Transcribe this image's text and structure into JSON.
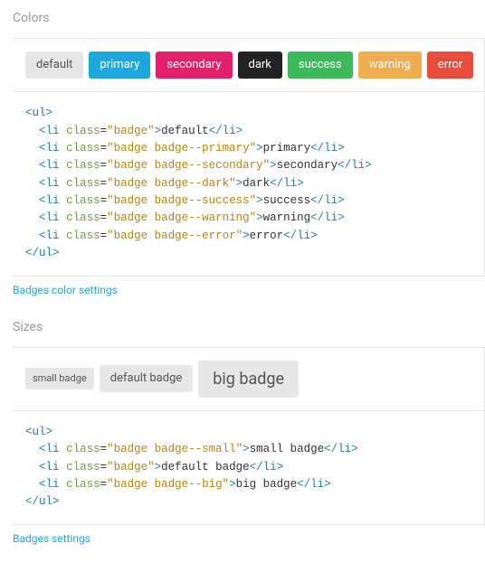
{
  "sections": {
    "colors": {
      "title": "Colors",
      "badges": [
        {
          "label": "default",
          "cls": "badge"
        },
        {
          "label": "primary",
          "cls": "badge badge--primary"
        },
        {
          "label": "secondary",
          "cls": "badge badge--secondary"
        },
        {
          "label": "dark",
          "cls": "badge badge--dark"
        },
        {
          "label": "success",
          "cls": "badge badge--success"
        },
        {
          "label": "warning",
          "cls": "badge badge--warning"
        },
        {
          "label": "error",
          "cls": "badge badge--error"
        }
      ],
      "code_lines": [
        {
          "tag": "ul",
          "open": true
        },
        {
          "tag": "li",
          "cls": "badge",
          "text": "default",
          "indent": 1
        },
        {
          "tag": "li",
          "cls": "badge badge--primary",
          "text": "primary",
          "indent": 1
        },
        {
          "tag": "li",
          "cls": "badge badge--secondary",
          "text": "secondary",
          "indent": 1
        },
        {
          "tag": "li",
          "cls": "badge badge--dark",
          "text": "dark",
          "indent": 1
        },
        {
          "tag": "li",
          "cls": "badge badge--success",
          "text": "success",
          "indent": 1
        },
        {
          "tag": "li",
          "cls": "badge badge--warning",
          "text": "warning",
          "indent": 1
        },
        {
          "tag": "li",
          "cls": "badge badge--error",
          "text": "error",
          "indent": 1
        },
        {
          "tag": "ul",
          "close": true
        }
      ],
      "link_label": "Badges color settings"
    },
    "sizes": {
      "title": "Sizes",
      "badges": [
        {
          "label": "small badge",
          "cls": "badge badge--small"
        },
        {
          "label": "default badge",
          "cls": "badge"
        },
        {
          "label": "big badge",
          "cls": "badge badge--big"
        }
      ],
      "code_lines": [
        {
          "tag": "ul",
          "open": true
        },
        {
          "tag": "li",
          "cls": "badge badge--small",
          "text": "small badge",
          "indent": 1
        },
        {
          "tag": "li",
          "cls": "badge",
          "text": "default badge",
          "indent": 1
        },
        {
          "tag": "li",
          "cls": "badge badge--big",
          "text": "big badge",
          "indent": 1
        },
        {
          "tag": "ul",
          "close": true
        }
      ],
      "link_label": "Badges settings"
    }
  }
}
